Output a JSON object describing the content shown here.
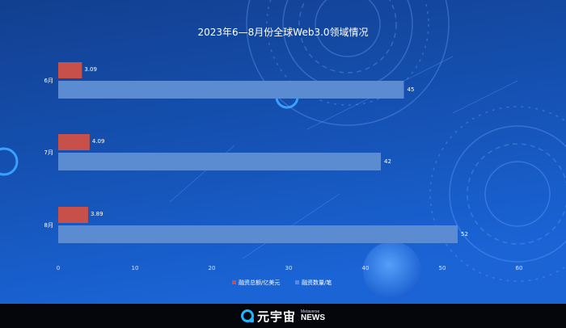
{
  "chart_data": {
    "type": "bar",
    "orientation": "horizontal",
    "title": "2023年6—8月份全球Web3.0领域情况",
    "categories": [
      "6月",
      "7月",
      "8月"
    ],
    "series": [
      {
        "name": "融资总额/亿美元",
        "values": [
          3.09,
          4.09,
          3.89
        ],
        "color": "#c8504a"
      },
      {
        "name": "融资数量/笔",
        "values": [
          45,
          42,
          52
        ],
        "color": "#5b8bd0"
      }
    ],
    "xlim": [
      0,
      60
    ],
    "xticks": [
      0,
      10,
      20,
      30,
      40,
      50,
      60
    ],
    "grid": false,
    "legend_position": "bottom"
  },
  "footer": {
    "brand": "元宇宙",
    "brand_sub_top": "Metaverse",
    "brand_sub_bottom": "NEWS"
  },
  "colors": {
    "background_top": "#0f3f93",
    "background_bottom": "#1658c8",
    "text": "#ffffff",
    "footer_bg": "#04060c"
  }
}
